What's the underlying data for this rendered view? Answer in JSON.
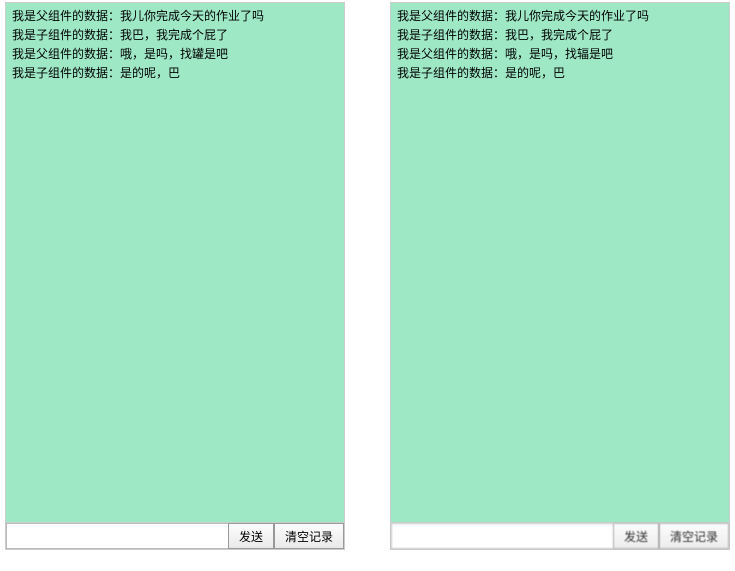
{
  "left": {
    "messages": [
      "我是父组件的数据：我儿你完成今天的作业了吗",
      "我是子组件的数据：我巴，我完成个屁了",
      "我是父组件的数据：哦，是吗，找罐是吧",
      "我是子组件的数据：是的呢，巴"
    ],
    "input_value": "",
    "send_label": "发送",
    "clear_label": "清空记录"
  },
  "right": {
    "messages": [
      "我是父组件的数据：我儿你完成今天的作业了吗",
      "我是子组件的数据：我巴，我完成个屁了",
      "我是父组件的数据：哦，是吗，找辐是吧",
      "我是子组件的数据：是的呢，巴"
    ],
    "input_value": "",
    "send_label": "发送",
    "clear_label": "清空记录"
  },
  "colors": {
    "chat_bg": "#9fe8c6"
  }
}
